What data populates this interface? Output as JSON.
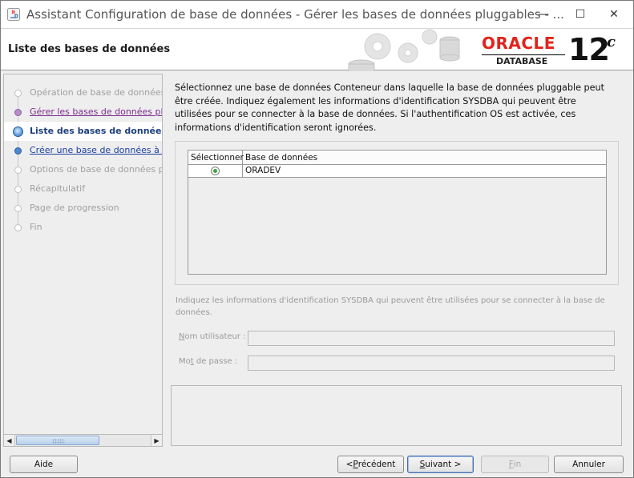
{
  "window": {
    "title": "Assistant Configuration de base de données - Gérer les bases de données pluggables - ...",
    "controls": {
      "minimize": "—",
      "maximize": "☐",
      "close": "✕"
    }
  },
  "header": {
    "title": "Liste des bases de données",
    "logo": {
      "brand": "ORACLE",
      "product": "DATABASE",
      "version": "12",
      "version_suffix": "c"
    }
  },
  "nav": {
    "items": [
      {
        "label": "Opération de base de données",
        "state": "disabled"
      },
      {
        "label": "Gérer les bases de données pluggables",
        "state": "visited"
      },
      {
        "label": "Liste des bases de données",
        "state": "current"
      },
      {
        "label": "Créer une base de données à la conteneur",
        "state": "link"
      },
      {
        "label": "Options de base de données pluggable",
        "state": "disabled"
      },
      {
        "label": "Récapitulatif",
        "state": "disabled"
      },
      {
        "label": "Page de progression",
        "state": "disabled"
      },
      {
        "label": "Fin",
        "state": "disabled"
      }
    ]
  },
  "content": {
    "instructions": "Sélectionnez une base de données Conteneur dans laquelle la base de données pluggable peut être créée. Indiquez également les informations d'identification SYSDBA qui peuvent être utilisées pour se connecter à la base de données. Si l'authentification OS est activée, ces informations d'identification seront ignorées.",
    "table": {
      "columns": [
        "Sélectionner",
        "Base de données"
      ],
      "rows": [
        {
          "selected": true,
          "database": "ORADEV"
        }
      ]
    },
    "credentials_note": "Indiquez les informations d'identification SYSDBA qui peuvent être utilisées pour se connecter à la base de données.",
    "username_label": "Nom utilisateur :",
    "username_mnemonic": "N",
    "username_rest": "om utilisateur :",
    "username_value": "",
    "password_label": "Mot de passe :",
    "password_pre": "Mo",
    "password_mnemonic": "t",
    "password_rest": " de passe :",
    "password_value": ""
  },
  "buttons": {
    "help": "Aide",
    "previous_prefix": "< ",
    "previous_mnemonic": "P",
    "previous_rest": "récédent",
    "next_mnemonic": "S",
    "next_rest": "uivant >",
    "finish_mnemonic": "F",
    "finish_rest": "in",
    "cancel": "Annuler"
  }
}
